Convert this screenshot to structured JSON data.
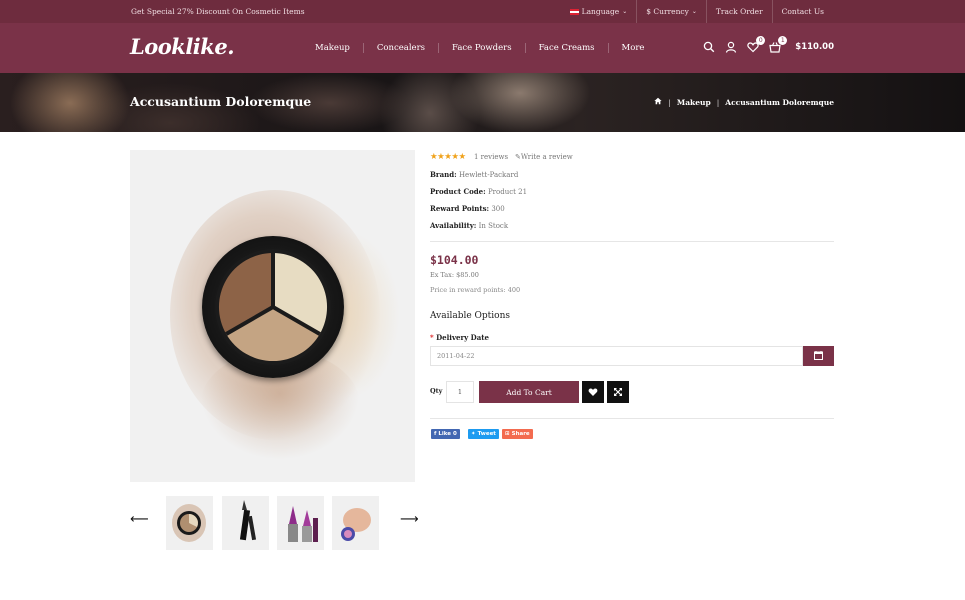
{
  "topbar": {
    "promo": "Get Special 27% Discount On Cosmetic Items",
    "language": "Language",
    "currency": "$ Currency",
    "track_order": "Track Order",
    "contact": "Contact Us"
  },
  "header": {
    "logo": "Looklike.",
    "nav": [
      "Makeup",
      "Concealers",
      "Face Powders",
      "Face Creams",
      "More"
    ],
    "wishlist_count": "0",
    "cart_count": "1",
    "cart_total": "$110.00"
  },
  "banner": {
    "title": "Accusantium Doloremque",
    "breadcrumb": [
      "Makeup",
      "Accusantium Doloremque"
    ]
  },
  "product": {
    "rating_stars": "★★★★★",
    "rating_value": 5,
    "reviews_link": "1 reviews",
    "write_review": "Write a review",
    "specs": [
      {
        "label": "Brand:",
        "value": "Hewlett-Packard"
      },
      {
        "label": "Product Code:",
        "value": "Product 21"
      },
      {
        "label": "Reward Points:",
        "value": "300"
      },
      {
        "label": "Availability:",
        "value": "In Stock"
      }
    ],
    "price": "$104.00",
    "ex_tax": "Ex Tax: $85.00",
    "reward_price": "Price in reward points: 400",
    "options_title": "Available Options",
    "delivery_label": "Delivery Date",
    "delivery_value": "2011-04-22",
    "qty_label": "Qty",
    "qty_value": "1",
    "add_to_cart": "Add To Cart",
    "share": {
      "like": "Like 0",
      "tweet": "Tweet",
      "share": "Share"
    }
  },
  "colors": {
    "brand": "#7a3248",
    "topbar": "#6e2c3e",
    "star": "#f0a21b"
  }
}
